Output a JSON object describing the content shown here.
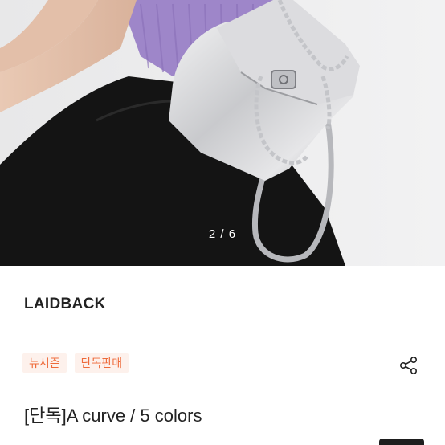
{
  "product": {
    "image_alt": "Silver leather mini backpack with chain strap",
    "page_indicator": "2 / 6",
    "brand": "LAIDBACK",
    "tags": [
      "뉴시즌",
      "단독판매"
    ],
    "title": "[단독]A curve / 5 colors"
  },
  "icons": {
    "share": "share-icon"
  },
  "colors": {
    "accent": "#ee6a3a",
    "tag_background": "#fdf1ec",
    "text": "#222222"
  }
}
